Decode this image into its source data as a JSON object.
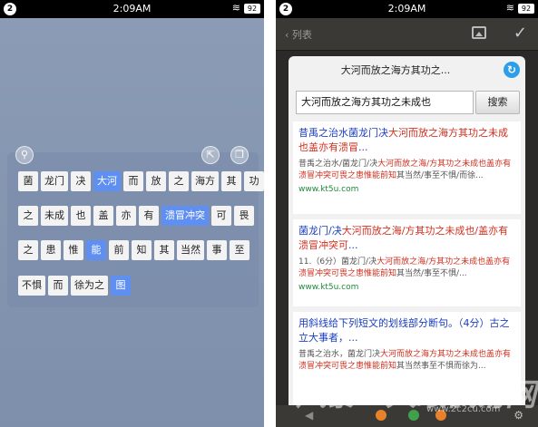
{
  "status": {
    "left_num": "2",
    "time": "2:09AM",
    "battery": "92"
  },
  "left_panel": {
    "rows": [
      [
        {
          "t": "菌",
          "s": false
        },
        {
          "t": "龙门",
          "s": false
        },
        {
          "t": "决",
          "s": false
        },
        {
          "t": "大河",
          "s": true
        },
        {
          "t": "而",
          "s": false
        },
        {
          "t": "放",
          "s": false
        },
        {
          "t": "之",
          "s": false
        },
        {
          "t": "海方",
          "s": false
        },
        {
          "t": "其",
          "s": false
        },
        {
          "t": "功",
          "s": false
        }
      ],
      [
        {
          "t": "之",
          "s": false
        },
        {
          "t": "未成",
          "s": false
        },
        {
          "t": "也",
          "s": false
        },
        {
          "t": "盖",
          "s": false
        },
        {
          "t": "亦",
          "s": false
        },
        {
          "t": "有",
          "s": false
        },
        {
          "t": "溃冒冲突",
          "s": true
        },
        {
          "t": "可",
          "s": false
        },
        {
          "t": "畏",
          "s": false
        }
      ],
      [
        {
          "t": "之",
          "s": false
        },
        {
          "t": "患",
          "s": false
        },
        {
          "t": "惟",
          "s": false
        },
        {
          "t": "能",
          "s": true
        },
        {
          "t": "前",
          "s": false
        },
        {
          "t": "知",
          "s": false
        },
        {
          "t": "其",
          "s": false
        },
        {
          "t": "当然",
          "s": false
        },
        {
          "t": "事",
          "s": false
        },
        {
          "t": "至",
          "s": false
        }
      ],
      [
        {
          "t": "不惧",
          "s": false
        },
        {
          "t": "而",
          "s": false
        },
        {
          "t": "徐为之",
          "s": false
        },
        {
          "t": "图",
          "s": true
        }
      ]
    ]
  },
  "right_panel": {
    "back_label": "列表",
    "card_title": "大河而放之海方其功之...",
    "search_value": "大河而放之海方其功之未成也",
    "search_button": "搜索",
    "results": [
      {
        "title_pre": "昔禹之治水菌龙门决",
        "title_hl": "大河而放之海方其功之未成也盖亦有溃冒",
        "title_post": "...",
        "snippet_pre": "昔禹之治水/菌龙门/决",
        "snippet_hl": "大河而放之海/方其功之未成也盖亦有溃冒冲突可畏之患惟能前知",
        "snippet_post": "其当然/事至不惧/而徐...",
        "url": "www.kt5u.com"
      },
      {
        "title_pre": "菌龙门/决",
        "title_hl": "大河而放之海/方其功之未成也/盖亦有溃冒冲突可",
        "title_post": "...",
        "snippet_pre": "11.（6分）菌龙门/决",
        "snippet_hl": "大河而放之海/方其功之未成也盖亦有溃冒冲突可畏之患惟能前知",
        "snippet_post": "其当然/事至不惧/...",
        "url": "www.kt5u.com"
      },
      {
        "title_pre": "用斜线给下列短文的划线部分断句。（4分）古之立大事者，...",
        "title_hl": "",
        "title_post": "",
        "snippet_pre": "昔禹之治水，菌龙门决",
        "snippet_hl": "大河而放之海方其功之未成也盖亦有溃冒冲突可畏之患惟能前知",
        "snippet_post": "其当然事至不惧而徐为...",
        "url": ""
      }
    ]
  },
  "watermark": {
    "text": "风暴—人眼快易网",
    "sub": "www.2c2cu.com"
  },
  "icons": {
    "search": "search-icon",
    "share": "share-icon",
    "copy": "copy-icon",
    "back": "back-chevron-icon",
    "image": "image-icon",
    "check": "check-icon",
    "refresh": "refresh-icon",
    "wifi": "wifi-icon",
    "settings": "gear-icon"
  },
  "colors": {
    "selected_chip": "#5f8ff0",
    "link": "#1a3ec2",
    "highlight": "#d12f1f",
    "url": "#1f8a38"
  }
}
